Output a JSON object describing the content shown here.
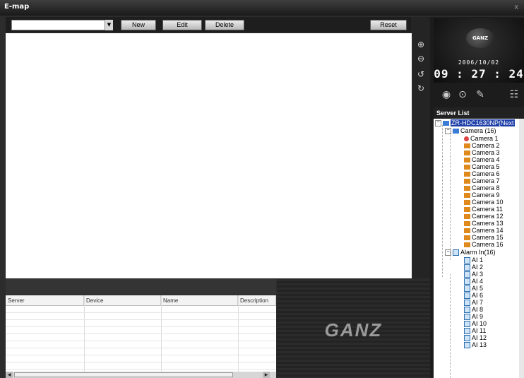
{
  "window": {
    "title": "E-map",
    "close_glyph": "x"
  },
  "toolbar": {
    "map_select_value": "",
    "new_label": "New",
    "edit_label": "Edit",
    "delete_label": "Delete",
    "reset_label": "Reset"
  },
  "zoom_tools": [
    "zoom-in-icon",
    "zoom-out-icon",
    "rotate-left-icon",
    "rotate-right-icon"
  ],
  "clock": {
    "brand": "GANZ",
    "date": "2006/10/02",
    "time": "09 : 27 : 24"
  },
  "server_list": {
    "header": "Server List",
    "server_name": "ZR-HDC1630NP(Next",
    "camera_group": "Camera (16)",
    "cameras": [
      "Camera 1",
      "Camera 2",
      "Camera 3",
      "Camera 4",
      "Camera 5",
      "Camera 6",
      "Camera 7",
      "Camera 8",
      "Camera 9",
      "Camera 10",
      "Camera 11",
      "Camera 12",
      "Camera 13",
      "Camera 14",
      "Camera 15",
      "Camera 16"
    ],
    "alarm_group": "Alarm In(16)",
    "alarms": [
      "AI 1",
      "AI 2",
      "AI 3",
      "AI 4",
      "AI 5",
      "AI 6",
      "AI 7",
      "AI 8",
      "AI 9",
      "AI 10",
      "AI 11",
      "AI 12",
      "AI 13"
    ]
  },
  "event_table": {
    "columns": [
      "Server",
      "Device",
      "Name",
      "Description"
    ]
  },
  "brand_logo": "GANZ",
  "colors": {
    "selection": "#1e3fa8",
    "camera_icon": "#e08a1e",
    "panel_dark": "#1c1c1c"
  }
}
